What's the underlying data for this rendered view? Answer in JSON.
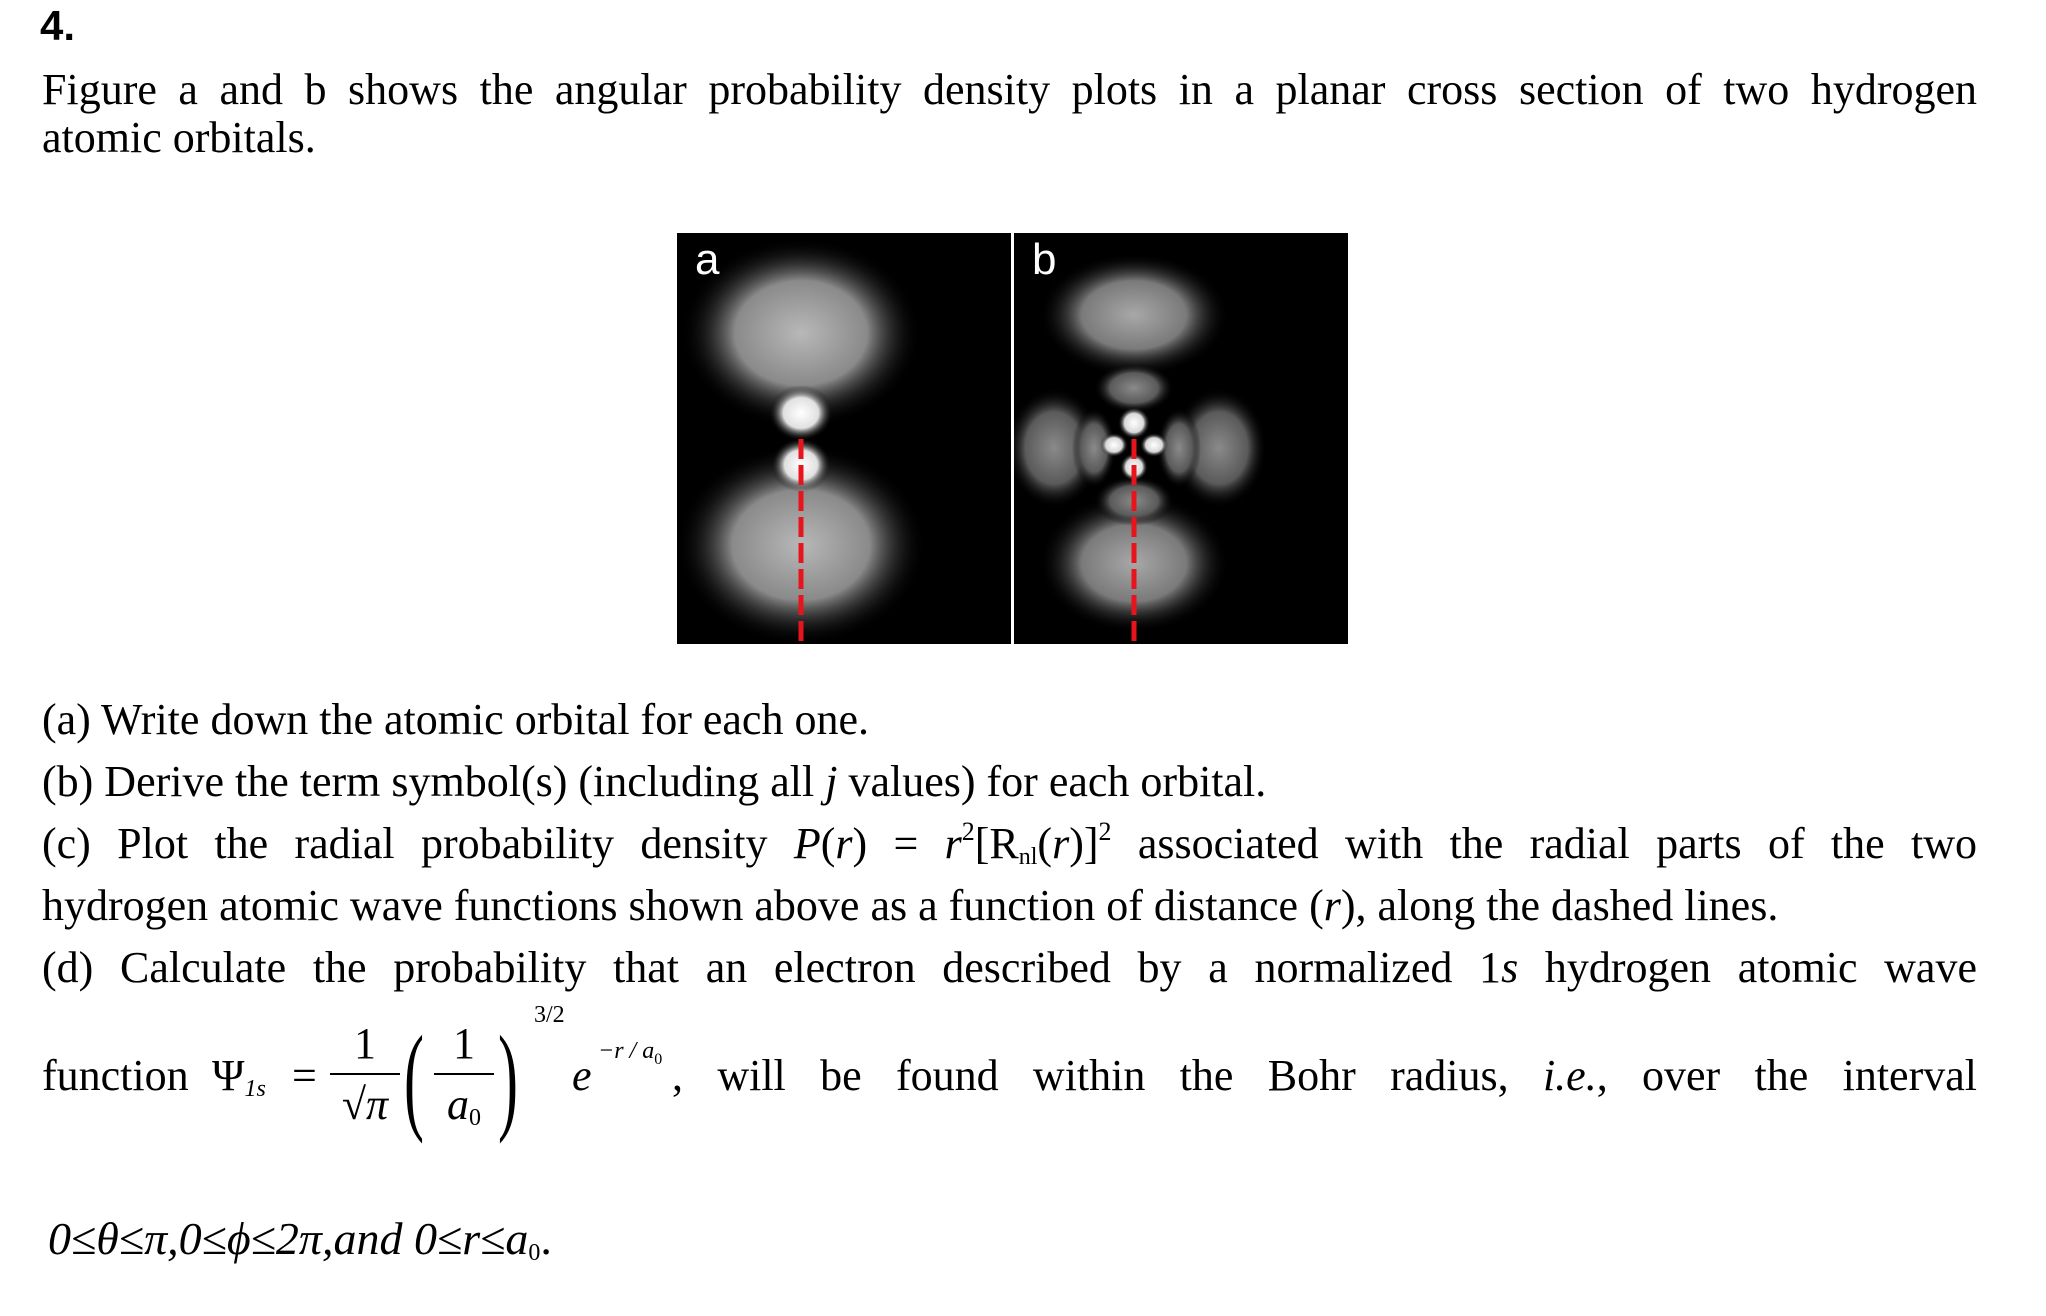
{
  "question": {
    "number": "4.",
    "intro_line1": "Figure a and b shows the angular probability density plots in a planar cross section of two hydrogen",
    "intro_line2": "atomic orbitals."
  },
  "figure": {
    "panels": [
      {
        "label": "a",
        "dashed_line_color": "#e8141c"
      },
      {
        "label": "b",
        "dashed_line_color": "#e8141c"
      }
    ]
  },
  "parts": {
    "a": "(a) Write down the atomic orbital for each one.",
    "b_prefix": "(b) Derive the term symbol(s) (including all ",
    "b_italic": "j",
    "b_suffix": " values) for each orbital.",
    "c_prefix": "(c) Plot the radial probability density ",
    "c_P": "P",
    "c_r1": "r",
    "c_eq": ") = ",
    "c_r2": "r",
    "c_sq": "2",
    "c_R": "[R",
    "c_nl": "nl",
    "c_r3": "r",
    "c_close": ")]",
    "c_sq2": "2",
    "c_suffix": " associated with the radial parts of the two",
    "c_line2_prefix": "hydrogen atomic wave functions shown above as a function of distance (",
    "c_line2_r": "r",
    "c_line2_suffix": "), along the dashed lines.",
    "d_line1_prefix": "(d) Calculate the probability that an electron described by a normalized 1",
    "d_line1_s": "s",
    "d_line1_suffix": " hydrogen atomic wave",
    "d_function": "function",
    "d_psi": "Ψ",
    "d_psi_sub": "1s",
    "d_equals": "=",
    "d_frac1_num": "1",
    "d_frac1_den": "√π",
    "d_frac2_num": "1",
    "d_frac2_den": "a",
    "d_frac2_den_sub": "0",
    "d_power": "3/2",
    "d_e": "e",
    "d_e_exp": "−r / a",
    "d_e_exp_sub": "0",
    "d_rest": ", will be found within the Bohr radius, ",
    "d_ie": "i.e.",
    "d_rest2": ", over the interval",
    "d_condition": "0≤θ≤π,0≤ϕ≤2π,and 0≤r≤a",
    "d_condition_sub": "0",
    "d_condition_end": "."
  }
}
